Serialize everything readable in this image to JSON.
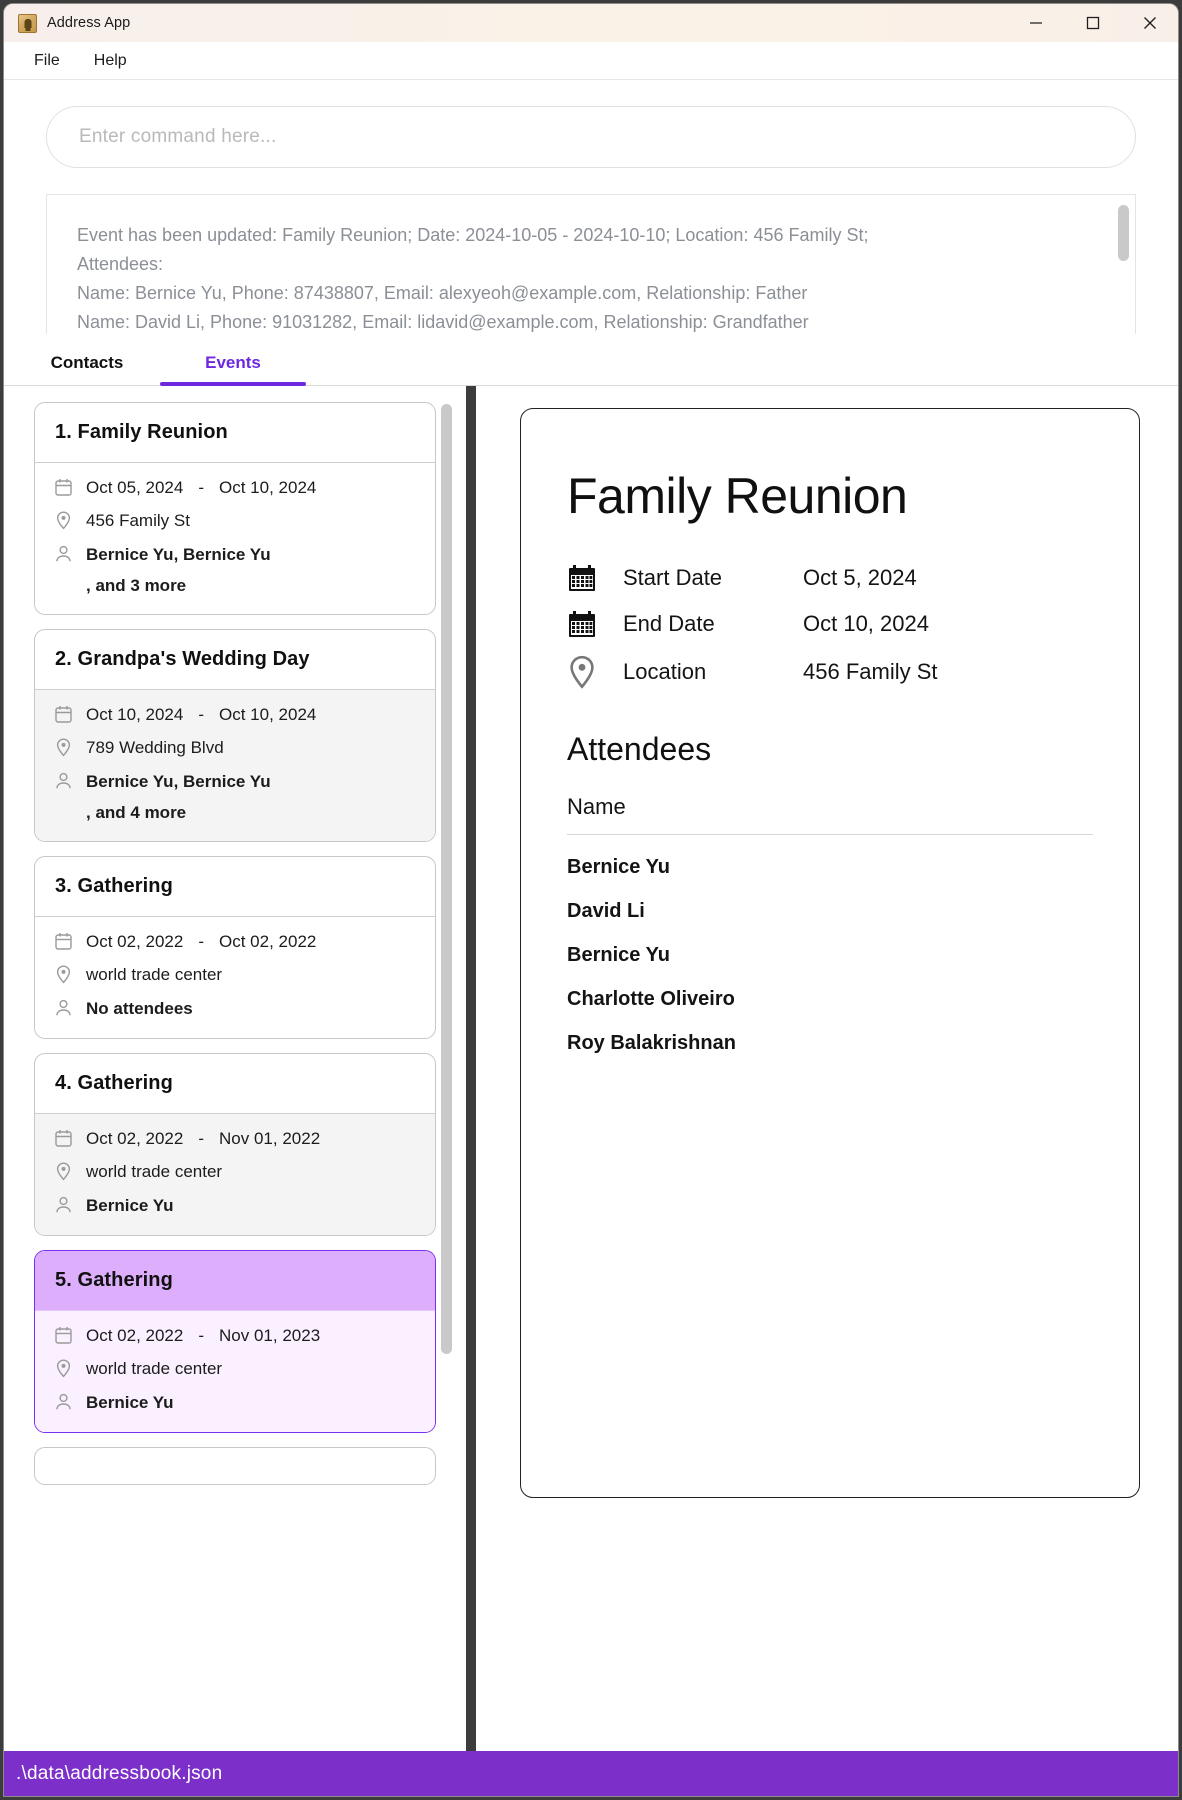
{
  "window": {
    "title": "Address App",
    "app_icon": "address-book-icon",
    "controls": {
      "minimize": "minimize-icon",
      "maximize": "maximize-icon",
      "close": "close-icon"
    }
  },
  "menubar": {
    "items": [
      {
        "label": "File"
      },
      {
        "label": "Help"
      }
    ]
  },
  "command": {
    "placeholder": "Enter command here...",
    "value": "",
    "result_lines": [
      "Event has been updated: Family Reunion; Date: 2024-10-05 - 2024-10-10; Location: 456 Family St;",
      "Attendees:",
      "Name: Bernice Yu, Phone: 87438807, Email: alexyeoh@example.com, Relationship: Father",
      "Name: David Li, Phone: 91031282, Email: lidavid@example.com, Relationship: Grandfather"
    ]
  },
  "tabs": [
    {
      "label": "Contacts",
      "active": false
    },
    {
      "label": "Events",
      "active": true
    }
  ],
  "event_list": [
    {
      "title": "1. Family Reunion",
      "start_date": "Oct 05, 2024",
      "date_separator": "-",
      "end_date": "Oct 10, 2024",
      "location": "456 Family St",
      "attendees": "Bernice Yu, Bernice Yu",
      "attendees_more": ", and 3 more",
      "state": "normal"
    },
    {
      "title": "2. Grandpa's Wedding Day",
      "start_date": "Oct 10, 2024",
      "date_separator": "-",
      "end_date": "Oct 10, 2024",
      "location": "789 Wedding Blvd",
      "attendees": "Bernice Yu, Bernice Yu",
      "attendees_more": ", and 4 more",
      "state": "hovered"
    },
    {
      "title": "3. Gathering",
      "start_date": "Oct 02, 2022",
      "date_separator": "-",
      "end_date": "Oct 02, 2022",
      "location": "world trade center",
      "attendees": "No attendees",
      "attendees_more": "",
      "state": "normal"
    },
    {
      "title": "4. Gathering",
      "start_date": "Oct 02, 2022",
      "date_separator": "-",
      "end_date": "Nov 01, 2022",
      "location": "world trade center",
      "attendees": "Bernice Yu",
      "attendees_more": "",
      "state": "hovered"
    },
    {
      "title": "5. Gathering",
      "start_date": "Oct 02, 2022",
      "date_separator": "-",
      "end_date": "Nov 01, 2023",
      "location": "world trade center",
      "attendees": "Bernice Yu",
      "attendees_more": "",
      "state": "selected"
    }
  ],
  "detail": {
    "title": "Family Reunion",
    "rows": [
      {
        "icon": "calendar-icon",
        "label": "Start Date",
        "value": "Oct 5, 2024"
      },
      {
        "icon": "calendar-icon",
        "label": "End Date",
        "value": "Oct 10, 2024"
      },
      {
        "icon": "location-pin-icon",
        "label": "Location",
        "value": "456 Family St"
      }
    ],
    "attendees_heading": "Attendees",
    "attendees_column": "Name",
    "attendees": [
      "Bernice Yu",
      "David Li",
      "Bernice Yu",
      "Charlotte Oliveiro",
      "Roy Balakrishnan"
    ]
  },
  "statusbar": {
    "path": ".\\data\\addressbook.json"
  },
  "colors": {
    "accent": "#6d28e0",
    "status_bar": "#7c2fc9",
    "selected_header": "#ddaefc",
    "selected_body": "#faf0ff",
    "titlebar": "#f9f0e8"
  }
}
